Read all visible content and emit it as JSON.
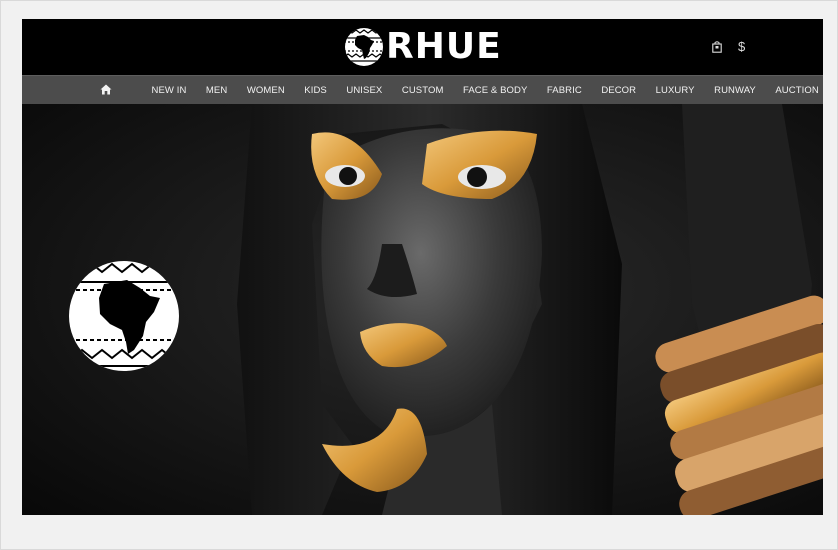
{
  "brand": {
    "name": "RHUE"
  },
  "header_icons": {
    "currency": "$"
  },
  "nav": {
    "items": [
      {
        "label": "NEW IN"
      },
      {
        "label": "MEN"
      },
      {
        "label": "WOMEN"
      },
      {
        "label": "KIDS"
      },
      {
        "label": "UNISEX"
      },
      {
        "label": "CUSTOM"
      },
      {
        "label": "FACE & BODY"
      },
      {
        "label": "FABRIC"
      },
      {
        "label": "DECOR"
      },
      {
        "label": "LUXURY"
      },
      {
        "label": "RUNWAY"
      },
      {
        "label": "AUCTION"
      }
    ]
  },
  "colors": {
    "header_bg": "#000000",
    "nav_bg": "#4c4c4c",
    "gold": "#d99a3a",
    "page_bg": "#f1f1f1"
  },
  "icons": [
    "home-icon",
    "cart-icon",
    "africa-logo-icon"
  ]
}
